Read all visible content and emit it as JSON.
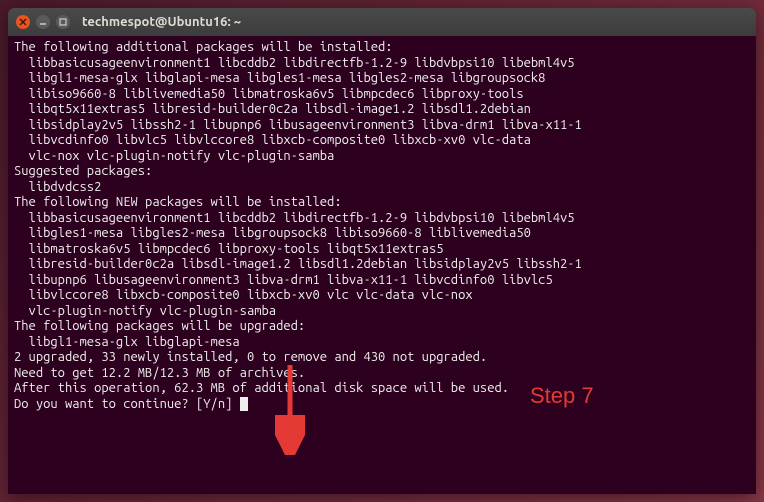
{
  "window": {
    "title": "techmespot@Ubuntu16: ~"
  },
  "terminal": {
    "lines": [
      "The following additional packages will be installed:",
      "  libbasicusageenvironment1 libcddb2 libdirectfb-1.2-9 libdvbpsi10 libebml4v5",
      "  libgl1-mesa-glx libglapi-mesa libgles1-mesa libgles2-mesa libgroupsock8",
      "  libiso9660-8 liblivemedia50 libmatroska6v5 libmpcdec6 libproxy-tools",
      "  libqt5x11extras5 libresid-builder0c2a libsdl-image1.2 libsdl1.2debian",
      "  libsidplay2v5 libssh2-1 libupnp6 libusageenvironment3 libva-drm1 libva-x11-1",
      "  libvcdinfo0 libvlc5 libvlccore8 libxcb-composite0 libxcb-xv0 vlc-data",
      "  vlc-nox vlc-plugin-notify vlc-plugin-samba",
      "Suggested packages:",
      "  libdvdcss2",
      "The following NEW packages will be installed:",
      "  libbasicusageenvironment1 libcddb2 libdirectfb-1.2-9 libdvbpsi10 libebml4v5",
      "  libgles1-mesa libgles2-mesa libgroupsock8 libiso9660-8 liblivemedia50",
      "  libmatroska6v5 libmpcdec6 libproxy-tools libqt5x11extras5",
      "  libresid-builder0c2a libsdl-image1.2 libsdl1.2debian libsidplay2v5 libssh2-1",
      "  libupnp6 libusageenvironment3 libva-drm1 libva-x11-1 libvcdinfo0 libvlc5",
      "  libvlccore8 libxcb-composite0 libxcb-xv0 vlc vlc-data vlc-nox",
      "  vlc-plugin-notify vlc-plugin-samba",
      "The following packages will be upgraded:",
      "  libgl1-mesa-glx libglapi-mesa",
      "2 upgraded, 33 newly installed, 0 to remove and 430 not upgraded.",
      "Need to get 12.2 MB/12.3 MB of archives.",
      "After this operation, 62.3 MB of additional disk space will be used.",
      "Do you want to continue? [Y/n] "
    ]
  },
  "annotation": {
    "label": "Step 7"
  }
}
